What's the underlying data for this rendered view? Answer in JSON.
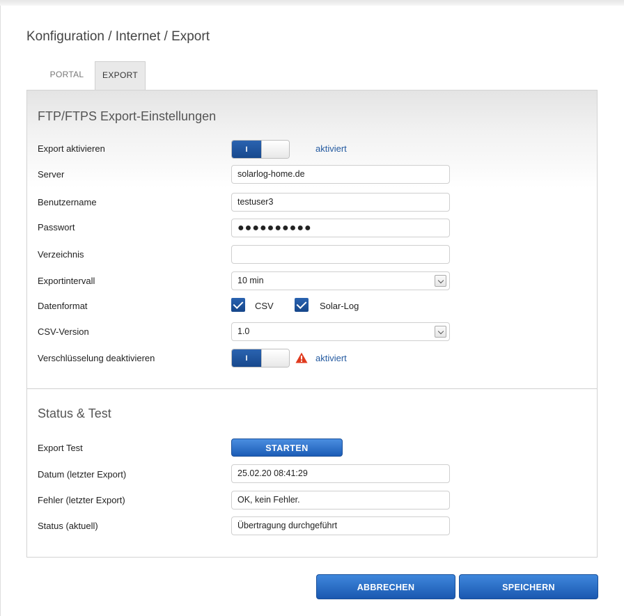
{
  "breadcrumb": "Konfiguration / Internet / Export",
  "tabs": [
    {
      "label": "PORTAL",
      "active": false
    },
    {
      "label": "EXPORT",
      "active": true
    }
  ],
  "ftp_section": {
    "title": "FTP/FTPS Export-Einstellungen",
    "export_enable": {
      "label": "Export aktivieren",
      "toggle_text": "I",
      "status": "aktiviert"
    },
    "server": {
      "label": "Server",
      "value": "solarlog-home.de"
    },
    "username": {
      "label": "Benutzername",
      "value": "testuser3"
    },
    "password": {
      "label": "Passwort",
      "value": "●●●●●●●●●●"
    },
    "directory": {
      "label": "Verzeichnis",
      "value": ""
    },
    "interval": {
      "label": "Exportintervall",
      "value": "10 min"
    },
    "data_format": {
      "label": "Datenformat",
      "options": [
        {
          "label": "CSV",
          "checked": true
        },
        {
          "label": "Solar-Log",
          "checked": true
        }
      ]
    },
    "csv_version": {
      "label": "CSV-Version",
      "value": "1.0"
    },
    "encryption": {
      "label": "Verschlüsselung deaktivieren",
      "toggle_text": "I",
      "status": "aktiviert",
      "warning_icon": "warning-triangle-icon"
    }
  },
  "status_section": {
    "title": "Status & Test",
    "export_test": {
      "label": "Export Test",
      "button": "STARTEN"
    },
    "last_date": {
      "label": "Datum (letzter Export)",
      "value": "25.02.20 08:41:29"
    },
    "last_error": {
      "label": "Fehler (letzter Export)",
      "value": "OK, kein Fehler."
    },
    "current_status": {
      "label": "Status (aktuell)",
      "value": "Übertragung durchgeführt"
    }
  },
  "footer": {
    "cancel": "ABBRECHEN",
    "save": "SPEICHERN"
  },
  "colors": {
    "accent": "#1f5db5",
    "link": "#245aa0",
    "warning": "#e03a1e"
  }
}
